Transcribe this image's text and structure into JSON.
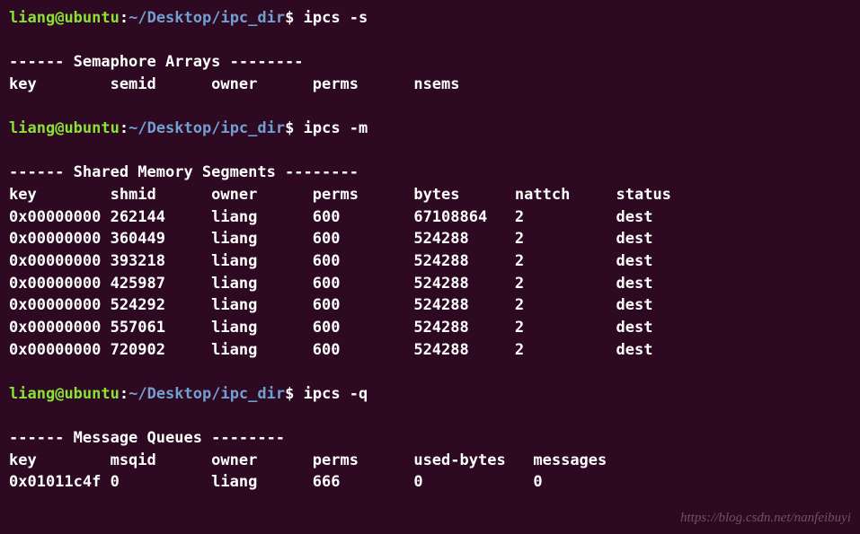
{
  "prompt": {
    "user": "liang",
    "host": "ubuntu",
    "path": "~/Desktop/ipc_dir",
    "symbol": "$"
  },
  "cmd1": "ipcs -s",
  "sem": {
    "title": "------ Semaphore Arrays --------",
    "header": "key        semid      owner      perms      nsems     "
  },
  "cmd2": "ipcs -m",
  "shm": {
    "title": "------ Shared Memory Segments --------",
    "header": "key        shmid      owner      perms      bytes      nattch     status      ",
    "rows": [
      "0x00000000 262144     liang      600        67108864   2          dest         ",
      "0x00000000 360449     liang      600        524288     2          dest         ",
      "0x00000000 393218     liang      600        524288     2          dest         ",
      "0x00000000 425987     liang      600        524288     2          dest         ",
      "0x00000000 524292     liang      600        524288     2          dest         ",
      "0x00000000 557061     liang      600        524288     2          dest         ",
      "0x00000000 720902     liang      600        524288     2          dest         "
    ]
  },
  "cmd3": "ipcs -q",
  "msg": {
    "title": "------ Message Queues --------",
    "header": "key        msqid      owner      perms      used-bytes   messages    ",
    "rows": [
      "0x01011c4f 0          liang      666        0            0           "
    ]
  },
  "watermark": "https://blog.csdn.net/nanfeibuyi"
}
